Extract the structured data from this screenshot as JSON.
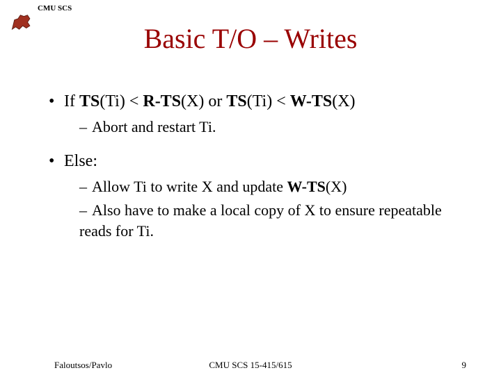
{
  "header": {
    "label": "CMU SCS"
  },
  "title": "Basic T/O – Writes",
  "bullets": {
    "b1_pre": "If ",
    "b1_ts1": "TS",
    "b1_ti1": "(Ti) < ",
    "b1_rts": "R-TS",
    "b1_x1": "(X) or ",
    "b1_ts2": "TS",
    "b1_ti2": "(Ti) < ",
    "b1_wts": "W-TS",
    "b1_x2": "(X)",
    "b1_sub1": "Abort and restart Ti.",
    "b2": "Else:",
    "b2_sub1_pre": "Allow Ti to write X and update ",
    "b2_sub1_wts": "W-TS",
    "b2_sub1_post": "(X)",
    "b2_sub2": "Also have to make a local copy of X to ensure repeatable reads for Ti."
  },
  "footer": {
    "left": "Faloutsos/Pavlo",
    "center": "CMU SCS 15-415/615",
    "right": "9"
  }
}
